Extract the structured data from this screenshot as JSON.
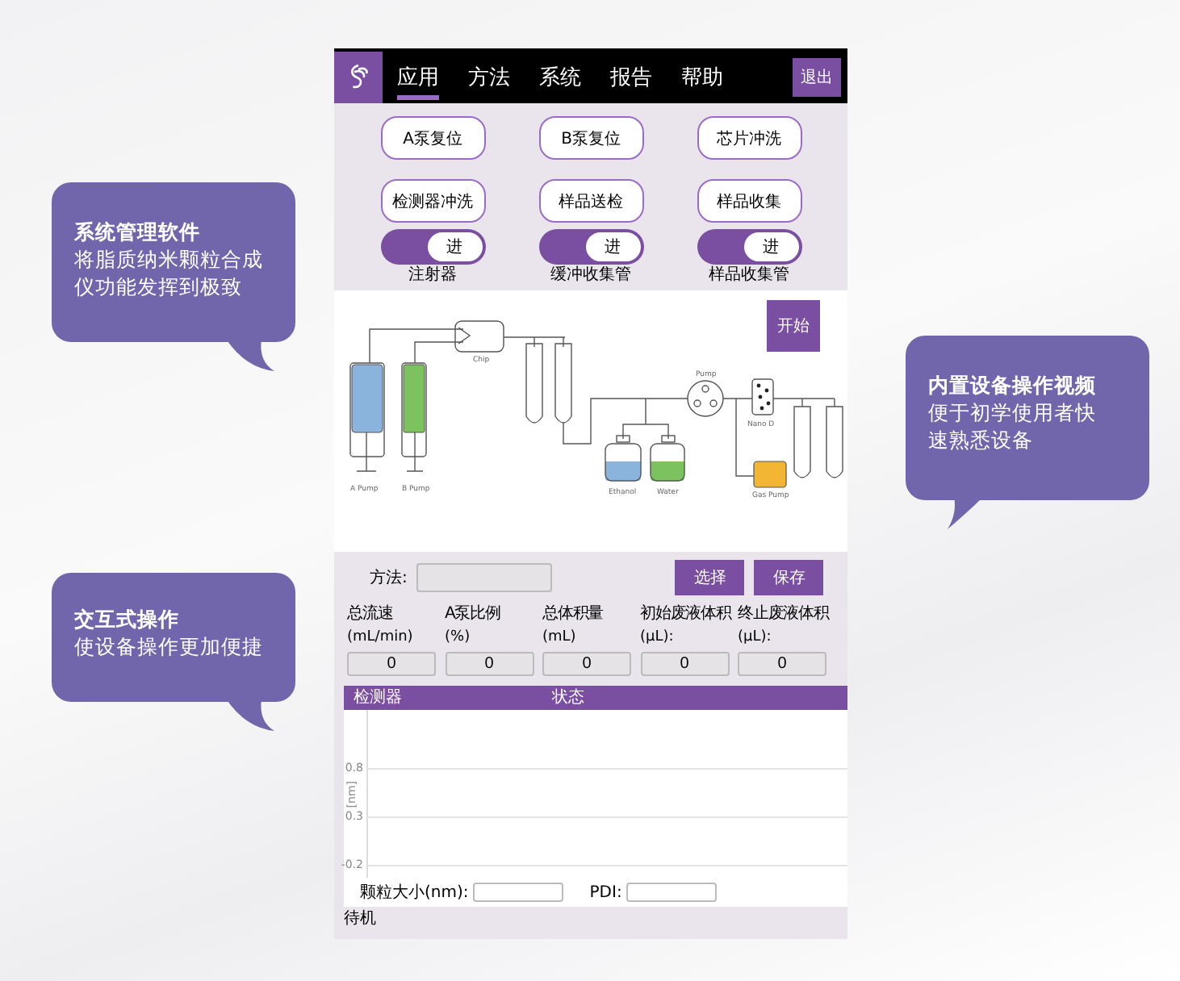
{
  "callouts": [
    {
      "title": "系统管理软件",
      "lines": [
        "将脂质纳米颗粒合成",
        "仪功能发挥到极致"
      ],
      "kind": "left"
    },
    {
      "title": "交互式操作",
      "lines": [
        "使设备操作更加便捷"
      ],
      "kind": "left"
    },
    {
      "title": "内置设备操作视频",
      "lines": [
        "便于初学使用者快",
        "速熟悉设备"
      ],
      "kind": "right"
    }
  ],
  "nav": {
    "tabs": [
      {
        "label": "应用",
        "selected": true
      },
      {
        "label": "方法",
        "selected": false
      },
      {
        "label": "系统",
        "selected": false
      },
      {
        "label": "报告",
        "selected": false
      },
      {
        "label": "帮助",
        "selected": false
      }
    ],
    "exit": "退出"
  },
  "actions": [
    "A泵复位",
    "B泵复位",
    "芯片冲洗",
    "检测器冲洗",
    "样品送检",
    "样品收集"
  ],
  "toggles": [
    {
      "label": "注射器",
      "state": "进",
      "on": true
    },
    {
      "label": "缓冲收集管",
      "state": "进",
      "on": true
    },
    {
      "label": "样品收集管",
      "state": "进",
      "on": true
    }
  ],
  "diagram": {
    "start": "开始",
    "labels": {
      "chip": "Chip",
      "a_pump": "A Pump",
      "b_pump": "B Pump",
      "pump": "Pump",
      "nano": "Nano D",
      "ethanol": "Ethanol",
      "water": "Water",
      "gas_pump": "Gas Pump"
    }
  },
  "method": {
    "label": "方法:",
    "select": "选择",
    "save": "保存"
  },
  "params": [
    {
      "name": "总流速",
      "unit": "(mL/min)",
      "value": "0"
    },
    {
      "name": "A泵比例",
      "unit": "(%)",
      "value": "0"
    },
    {
      "name": "总体积量",
      "unit": "(mL)",
      "value": "0"
    },
    {
      "name": "初始废液体积",
      "unit": "(μL):",
      "value": "0"
    },
    {
      "name": "终止废液体积",
      "unit": "(μL):",
      "value": "0"
    }
  ],
  "detector": {
    "columns": [
      "检测器",
      "状态"
    ]
  },
  "chart": {
    "ylabel": "[nm]",
    "yticks": [
      "0.8",
      "0.3",
      "-0.2"
    ]
  },
  "results": [
    {
      "label": "颗粒大小(nm):"
    },
    {
      "label": "PDI:"
    }
  ],
  "status_bar": "待机"
}
